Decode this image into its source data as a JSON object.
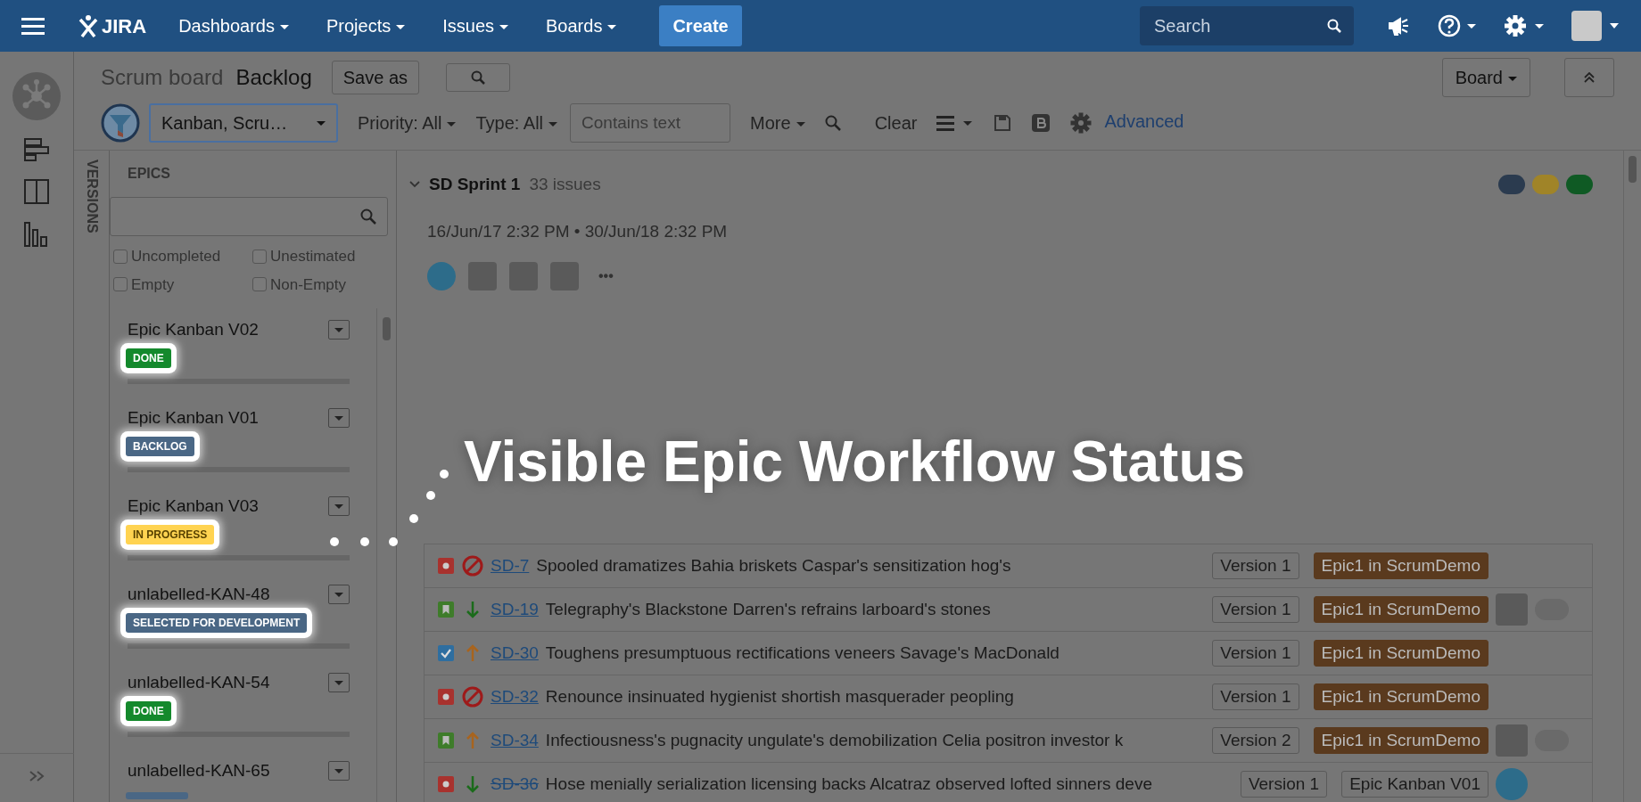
{
  "header": {
    "logo": "JIRA",
    "nav": [
      "Dashboards",
      "Projects",
      "Issues",
      "Boards"
    ],
    "create": "Create",
    "search": {
      "placeholder": "Search"
    }
  },
  "board": {
    "title": "Scrum board",
    "view": "Backlog",
    "save_as": "Save as",
    "board_menu": "Board"
  },
  "filters": {
    "quick_filter": "Kanban, Scru…",
    "priority": "Priority: All",
    "type": "Type: All",
    "text": {
      "placeholder": "Contains text"
    },
    "more": "More",
    "clear": "Clear",
    "advanced": "Advanced"
  },
  "versions_tab": "VERSIONS",
  "epics": {
    "title": "EPICS",
    "checkboxes": [
      {
        "label": "Uncompleted",
        "checked": false
      },
      {
        "label": "Unestimated",
        "checked": false
      },
      {
        "label": "Empty",
        "checked": false
      },
      {
        "label": "Non-Empty",
        "checked": false
      }
    ],
    "items": [
      {
        "name": "Epic Kanban V02",
        "status": "DONE",
        "color": "#14892c",
        "level": 0
      },
      {
        "name": "Epic Kanban V01",
        "status": "BACKLOG",
        "color": "#4a6785",
        "level": 0
      },
      {
        "name": "Epic Kanban V03",
        "status": "IN PROGRESS",
        "color": "#ffd351",
        "level": 0
      },
      {
        "name": "unlabelled-KAN-48",
        "status": "SELECTED FOR DEVELOPMENT",
        "color": "#4a6785",
        "level": 0
      },
      {
        "name": "unlabelled-KAN-54",
        "status": "DONE",
        "color": "#14892c",
        "level": 0
      },
      {
        "name": "unlabelled-KAN-65",
        "color": "#4a6785"
      }
    ]
  },
  "sprint": {
    "name": "SD Sprint 1",
    "count": "33 issues",
    "dates": "16/Jun/17 2:32 PM • 30/Jun/18 2:32 PM",
    "more": "•••",
    "status_counts": [
      {
        "color": "#2b3b4f"
      },
      {
        "color": "#a08428"
      },
      {
        "color": "#0f5a24"
      }
    ],
    "avatars": [
      {
        "kind": "cartoon"
      },
      {
        "kind": "photo"
      },
      {
        "kind": "photo"
      },
      {
        "kind": "photo"
      }
    ]
  },
  "headline": "Visible Epic Workflow Status",
  "issues": [
    {
      "kind": "bug",
      "priority": {
        "kind": "blocker"
      },
      "key": "SD-7",
      "resolved": false,
      "summary": "Spooled dramatizes Bahia briskets Caspar's sensitization hog's",
      "version": "Version 1",
      "epic": {
        "name": "Epic1 in ScrumDemo",
        "color": "#5a3a1e"
      },
      "toggle": false
    },
    {
      "kind": "story",
      "priority": {
        "kind": "low"
      },
      "key": "SD-19",
      "resolved": false,
      "summary": "Telegraphy's Blackstone Darren's refrains larboard's stones",
      "version": "Version 1",
      "epic": {
        "name": "Epic1 in ScrumDemo",
        "color": "#5a3a1e"
      },
      "assignee": {
        "kind": "photo"
      },
      "toggle": true
    },
    {
      "kind": "task",
      "priority": {
        "kind": "high"
      },
      "key": "SD-30",
      "resolved": false,
      "summary": "Toughens presumptuous rectifications veneers Savage's MacDonald",
      "version": "Version 1",
      "epic": {
        "name": "Epic1 in ScrumDemo",
        "color": "#5a3a1e"
      },
      "toggle": false
    },
    {
      "kind": "bug",
      "priority": {
        "kind": "blocker"
      },
      "key": "SD-32",
      "resolved": false,
      "summary": "Renounce insinuated hygienist shortish masquerader peopling",
      "version": "Version 1",
      "epic": {
        "name": "Epic1 in ScrumDemo",
        "color": "#5a3a1e"
      },
      "toggle": false
    },
    {
      "kind": "story",
      "priority": {
        "kind": "high"
      },
      "key": "SD-34",
      "resolved": false,
      "summary": "Infectiousness's pugnacity ungulate's demobilization Celia positron investor k",
      "version": "Version 2",
      "epic": {
        "name": "Epic1 in ScrumDemo",
        "color": "#5a3a1e"
      },
      "assignee": {
        "kind": "photo"
      },
      "toggle": true
    },
    {
      "kind": "bug",
      "priority": {
        "kind": "low"
      },
      "key": "SD-36",
      "resolved": true,
      "summary": "Hose menially serialization licensing backs Alcatraz observed lofted sinners deve",
      "version": "Version 1",
      "epic": {
        "name": "Epic Kanban V01"
      },
      "assignee": {
        "kind": "cartoon"
      },
      "toggle": false
    }
  ]
}
